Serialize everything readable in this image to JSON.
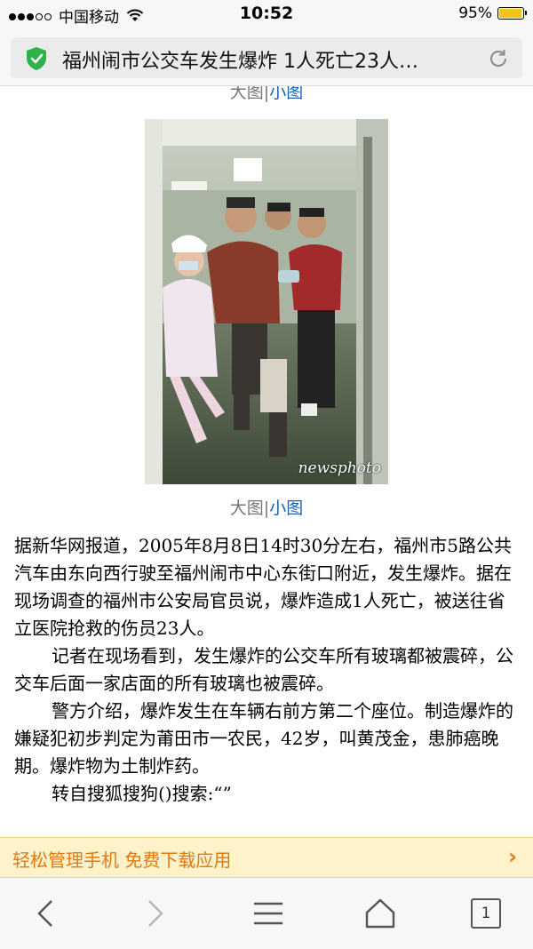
{
  "status_bar": {
    "carrier": "中国移动",
    "time": "10:52",
    "battery_percent": "95%",
    "battery_level": 0.95,
    "signal_bars": 3
  },
  "browser": {
    "page_title": "福州闹市公交车发生爆炸 1人死亡23人…"
  },
  "image_captions": {
    "large": "大图",
    "separator": "|",
    "small": "小图"
  },
  "photo": {
    "watermark": "newsphoto"
  },
  "article": {
    "paragraphs": [
      "据新华网报道，2005年8月8日14时30分左右，福州市5路公共汽车由东向西行驶至福州闹市中心东街口附近，发生爆炸。据在现场调查的福州市公安局官员说，爆炸造成1人死亡，被送往省立医院抢救的伤员23人。",
      "记者在现场看到，发生爆炸的公交车所有玻璃都被震碎，公交车后面一家店面的所有玻璃也被震碎。",
      "警方介绍，爆炸发生在车辆右前方第二个座位。制造爆炸的嫌疑犯初步判定为莆田市一农民，42岁，叫黄茂金，患肺癌晚期。爆炸物为土制炸药。",
      "转自搜狐搜狗()搜索:“”"
    ]
  },
  "banner": {
    "text": "轻松管理手机 免费下载应用",
    "chevron": "›"
  },
  "toolbar": {
    "tab_count": "1"
  },
  "colors": {
    "link": "#1a62b5",
    "banner_text": "#e07a12",
    "banner_bg": "#fdf2c9",
    "shield": "#2db34a",
    "battery": "#f5c21a"
  }
}
